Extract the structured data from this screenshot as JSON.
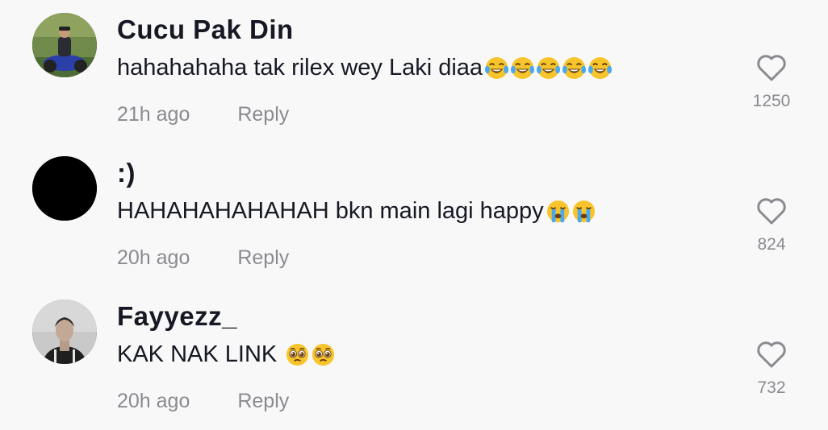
{
  "comments": [
    {
      "username": "Cucu Pak Din",
      "text": "hahahahaha tak rilex wey Laki diaa",
      "emojis": [
        "tears-of-joy-emoji",
        "tears-of-joy-emoji",
        "tears-of-joy-emoji",
        "tears-of-joy-emoji",
        "tears-of-joy-emoji"
      ],
      "time": "21h ago",
      "reply_label": "Reply",
      "likes": "1250"
    },
    {
      "username": ":)",
      "text": "HAHAHAHAHAHAH bkn main lagi happy",
      "emojis": [
        "loudly-crying-emoji",
        "loudly-crying-emoji"
      ],
      "time": "20h ago",
      "reply_label": "Reply",
      "likes": "824"
    },
    {
      "username": "Fayyezz_",
      "text": "KAK NAK LINK",
      "emojis": [
        "pleading-face-emoji",
        "pleading-face-emoji"
      ],
      "time": "20h ago",
      "reply_label": "Reply",
      "likes": "732"
    }
  ],
  "colors": {
    "background": "#f8f8f8",
    "primary_text": "#161823",
    "secondary_text": "#8a8b91",
    "heart_stroke": "#8a8b91"
  }
}
